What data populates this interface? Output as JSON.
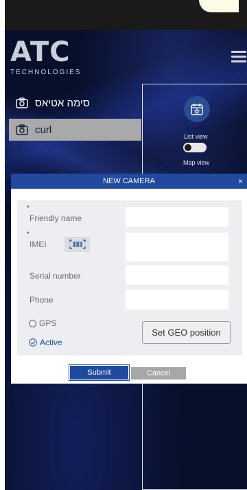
{
  "brand": {
    "logo_text": "ATC",
    "logo_subtext": "TECHNOLOGIES"
  },
  "camera_list": {
    "items": [
      {
        "label": "סימה אטיאס",
        "selected": false
      },
      {
        "label": "curl",
        "selected": true
      }
    ]
  },
  "view_panel": {
    "list_view_label": "List view",
    "map_view_label": "Map view",
    "toggle_state": "list"
  },
  "modal": {
    "title": "NEW CAMERA",
    "close_symbol": "×",
    "required_mark": "*",
    "fields": {
      "friendly_name": {
        "label": "Friendly name",
        "value": ""
      },
      "imei": {
        "label": "IMEI",
        "value": ""
      },
      "serial_number": {
        "label": "Serial number",
        "value": ""
      },
      "phone": {
        "label": "Phone",
        "value": ""
      }
    },
    "gps_label": "GPS",
    "active_label": "Active",
    "geo_button_label": "Set GEO position",
    "submit_label": "Submit",
    "cancel_label": "Cancel"
  },
  "colors": {
    "accent": "#1f4aa0",
    "background": "#070f2a",
    "selected_item": "#a9a9a9"
  }
}
